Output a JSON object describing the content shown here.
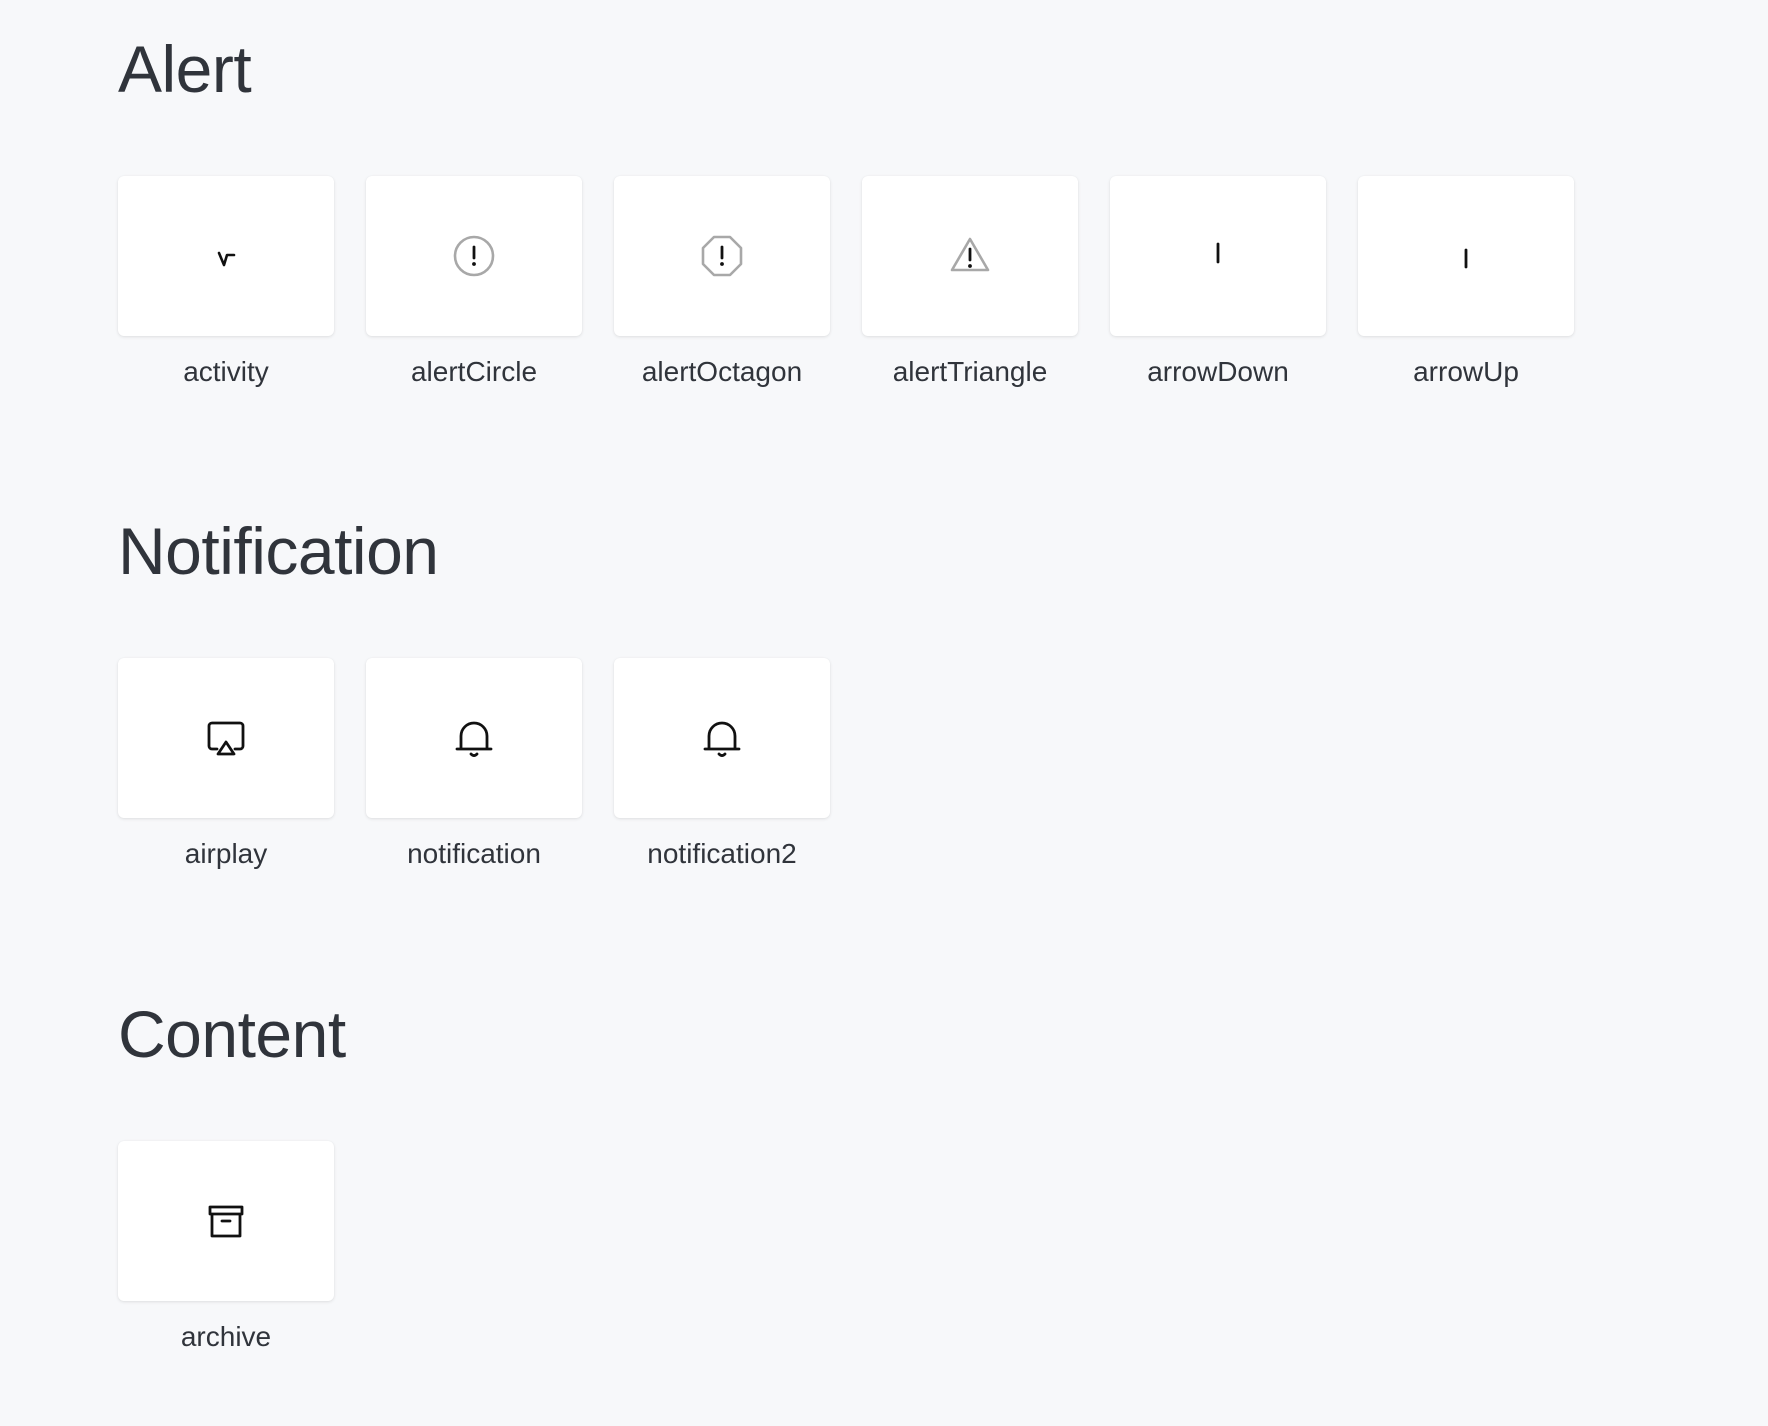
{
  "sections": [
    {
      "title": "Alert",
      "icons": [
        {
          "label": "activity",
          "icon": "activity-icon"
        },
        {
          "label": "alertCircle",
          "icon": "alert-circle-icon"
        },
        {
          "label": "alertOctagon",
          "icon": "alert-octagon-icon"
        },
        {
          "label": "alertTriangle",
          "icon": "alert-triangle-icon"
        },
        {
          "label": "arrowDown",
          "icon": "arrow-down-icon"
        },
        {
          "label": "arrowUp",
          "icon": "arrow-up-icon"
        }
      ]
    },
    {
      "title": "Notification",
      "icons": [
        {
          "label": "airplay",
          "icon": "airplay-icon"
        },
        {
          "label": "notification",
          "icon": "bell-icon"
        },
        {
          "label": "notification2",
          "icon": "bell-icon"
        }
      ]
    },
    {
      "title": "Content",
      "icons": [
        {
          "label": "archive",
          "icon": "archive-icon"
        }
      ]
    }
  ],
  "colors": {
    "background": "#f7f8fa",
    "card": "#ffffff",
    "text": "#30343b",
    "icon_dark": "#111111",
    "icon_gray": "#a8a8a8"
  }
}
